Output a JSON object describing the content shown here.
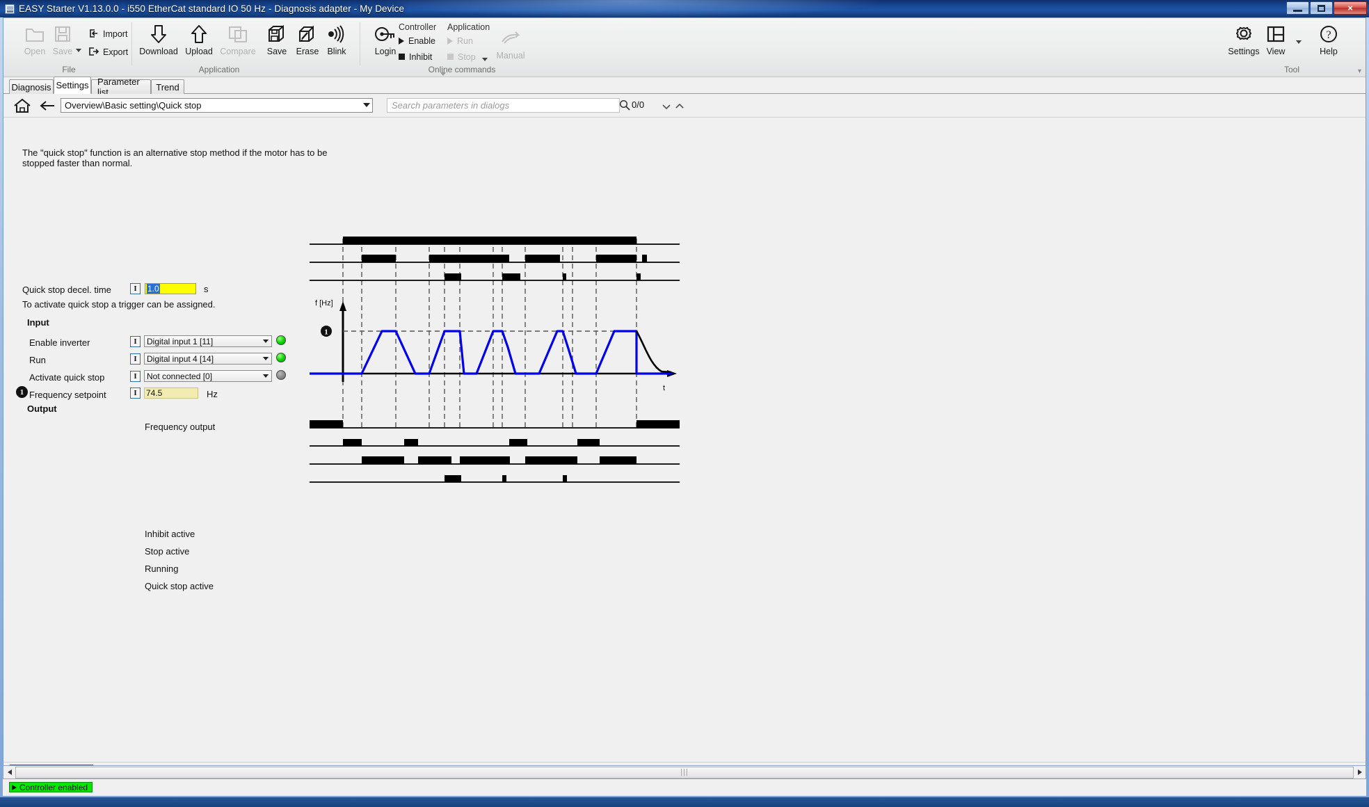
{
  "window": {
    "title": "EASY Starter V1.13.0.0 - i550 EtherCat standard IO 50 Hz - Diagnosis adapter - My Device",
    "icon": "app-icon",
    "buttons": {
      "minimize": "minimize-icon",
      "maximize": "maximize-icon",
      "close": "×"
    }
  },
  "ribbon": {
    "groups": [
      {
        "name": "file",
        "label": "File",
        "buttons": [
          {
            "id": "open",
            "label": "Open",
            "icon": "folder-open-icon",
            "disabled": true
          },
          {
            "id": "save",
            "label": "Save",
            "icon": "floppy-save-icon",
            "disabled": true
          },
          {
            "id": "import",
            "label": "Import",
            "icon": "import-arrow-icon",
            "disabled": false
          },
          {
            "id": "export",
            "label": "Export",
            "icon": "export-arrow-icon",
            "disabled": false
          }
        ]
      },
      {
        "name": "application",
        "label": "Application",
        "buttons": [
          {
            "id": "download",
            "label": "Download",
            "icon": "download-icon",
            "disabled": false
          },
          {
            "id": "upload",
            "label": "Upload",
            "icon": "upload-icon",
            "disabled": false
          },
          {
            "id": "compare",
            "label": "Compare",
            "icon": "compare-icon",
            "disabled": true
          },
          {
            "id": "save-app",
            "label": "Save",
            "icon": "save-device-icon",
            "disabled": false
          },
          {
            "id": "erase",
            "label": "Erase",
            "icon": "erase-device-icon",
            "disabled": false
          },
          {
            "id": "blink",
            "label": "Blink",
            "icon": "blink-signal-icon",
            "disabled": false
          }
        ]
      },
      {
        "name": "online-commands",
        "label": "Online commands",
        "buttons": [
          {
            "id": "login",
            "label": "Login",
            "icon": "key-login-icon",
            "disabled": false
          }
        ],
        "controller": {
          "header": "Controller",
          "enable": "Enable",
          "inhibit": "Inhibit"
        },
        "application": {
          "header": "Application",
          "run": "Run",
          "stop": "Stop"
        },
        "manual": {
          "label": "Manual",
          "icon": "hand-manual-icon"
        }
      },
      {
        "name": "tool",
        "label": "Tool",
        "buttons": [
          {
            "id": "settings",
            "label": "Settings",
            "icon": "gear-icon",
            "disabled": false
          },
          {
            "id": "view",
            "label": "View",
            "icon": "layout-view-icon",
            "disabled": false
          },
          {
            "id": "help",
            "label": "Help",
            "icon": "question-help-icon",
            "disabled": false
          }
        ]
      }
    ]
  },
  "tabs": [
    {
      "id": "diagnosis",
      "label": "Diagnosis",
      "active": false
    },
    {
      "id": "settings",
      "label": "Settings",
      "active": true
    },
    {
      "id": "parameter-list",
      "label": "Parameter list",
      "active": false
    },
    {
      "id": "trend",
      "label": "Trend",
      "active": false
    }
  ],
  "nav": {
    "home_icon": "home-icon",
    "back_icon": "back-arrow-icon",
    "path": "Overview\\Basic setting\\Quick stop",
    "dropdown_icon": "chevron-down-icon",
    "search_placeholder": "Search parameters in dialogs",
    "search_value": "",
    "search_icon": "search-icon",
    "search_count": "0/0",
    "next_icon": "chevron-down-icon",
    "prev_icon": "chevron-up-icon"
  },
  "page": {
    "description": "The \"quick stop\" function is an alternative stop method if the motor has to be stopped faster than normal.",
    "decel": {
      "label": "Quick stop decel. time",
      "badge": "I",
      "value": "1.0",
      "unit": "s",
      "selected": true
    },
    "trigger_note": "To activate quick stop a trigger can be assigned.",
    "input_header": "Input",
    "output_header": "Output",
    "inputs": [
      {
        "id": "enable-inverter",
        "label": "Enable inverter",
        "badge": "I",
        "value": "Digital input 1 [11]",
        "led": "on"
      },
      {
        "id": "run",
        "label": "Run",
        "badge": "I",
        "value": "Digital input 4 [14]",
        "led": "on"
      },
      {
        "id": "activate-quick-stop",
        "label": "Activate quick stop",
        "badge": "I",
        "value": "Not connected [0]",
        "led": "off"
      }
    ],
    "frequency_setpoint": {
      "marker": "1",
      "label": "Frequency setpoint",
      "badge": "I",
      "value": "74.5",
      "unit": "Hz"
    },
    "signal_labels_top": [],
    "output_labels": [
      "Frequency output",
      "Inhibit active",
      "Stop active",
      "Running",
      "Quick stop active"
    ]
  },
  "diagram": {
    "y_axis_label": "f [Hz]",
    "x_axis_label": "t",
    "marker": "1",
    "colors": {
      "signal": "#0000ee",
      "trace": "#000000",
      "grid": "#555555"
    }
  },
  "status": {
    "badge_label": "Controller enabled",
    "badge_icon": "play-triangle-icon",
    "badge_color": "#00ea00"
  },
  "scrollbar": {
    "left_icon": "scroll-left-icon",
    "right_icon": "scroll-right-icon",
    "grip": "|||"
  }
}
